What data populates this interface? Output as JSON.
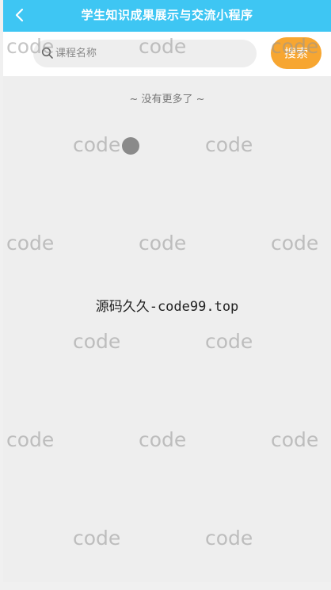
{
  "nav": {
    "title": "学生知识成果展示与交流小程序",
    "back_icon": "chevron-left-icon"
  },
  "search": {
    "placeholder": "课程名称",
    "button_label": "搜索",
    "icon": "search-icon"
  },
  "list": {
    "end_text": "~ 没有更多了 ~"
  },
  "watermark": {
    "text": "code",
    "caption": "源码久久-code99.top"
  },
  "colors": {
    "nav_bg": "#3ec6f3",
    "search_button_bg": "#f7a631",
    "page_bg": "#eeeeee"
  }
}
